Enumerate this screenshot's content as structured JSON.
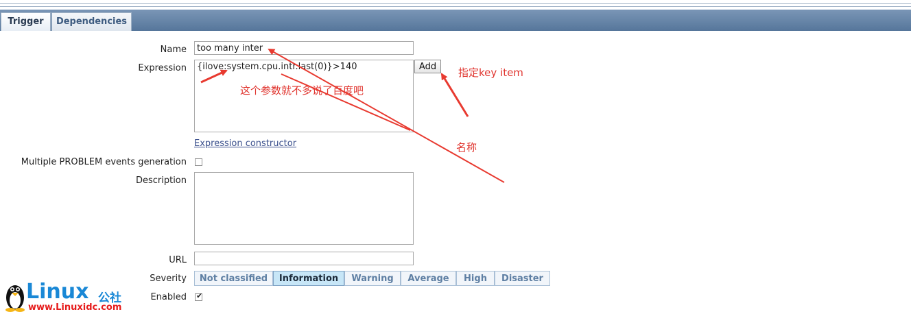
{
  "tabs": [
    {
      "label": "Trigger",
      "active": true
    },
    {
      "label": "Dependencies",
      "active": false
    }
  ],
  "form": {
    "name_label": "Name",
    "name_value": "too many inter",
    "expression_label": "Expression",
    "expression_value": "{ilove:system.cpu.intr.last(0)}>140",
    "add_label": "Add",
    "expression_constructor_label": "Expression constructor",
    "multiple_problem_label": "Multiple PROBLEM events generation",
    "multiple_problem_checked": false,
    "description_label": "Description",
    "description_value": "",
    "url_label": "URL",
    "url_value": "",
    "severity_label": "Severity",
    "severities": [
      "Not classified",
      "Information",
      "Warning",
      "Average",
      "High",
      "Disaster"
    ],
    "severity_selected": "Information",
    "enabled_label": "Enabled",
    "enabled_checked": true
  },
  "annotations": {
    "param_note": "这个参数就不多说了百度吧",
    "key_item_note": "指定key item",
    "name_note": "名称",
    "color": "#e0352f"
  },
  "watermark": {
    "brand": "Linux",
    "brand_cn": "公社",
    "url": "www.Linuxidc.com",
    "brand_color": "#1a88d6",
    "url_color": "#e61b1b"
  },
  "colors": {
    "tab_bar": "#56769b",
    "severity_selected_bg": "#c7e6f7"
  }
}
